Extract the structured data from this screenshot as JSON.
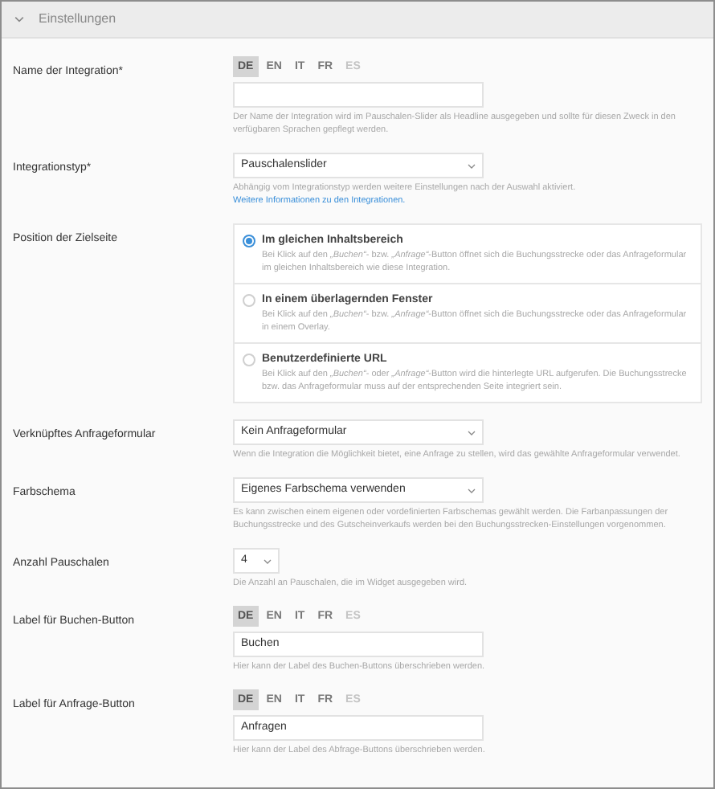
{
  "section": {
    "title": "Einstellungen",
    "expanded": true
  },
  "fields": [
    {
      "kind": "i18n",
      "label": "Name der Integration*",
      "languages": [
        {
          "code": "DE",
          "selected": true,
          "disabled": false
        },
        {
          "code": "EN",
          "selected": false,
          "disabled": false
        },
        {
          "code": "IT",
          "selected": false,
          "disabled": false
        },
        {
          "code": "FR",
          "selected": false,
          "disabled": false
        },
        {
          "code": "ES",
          "selected": false,
          "disabled": true
        }
      ],
      "help": "Der Name der Integration wird im Pauschalen-Slider als Headline ausgegeben und sollte für diesen Zweck in den verfügbaren Sprachen gepflegt werden."
    },
    {
      "kind": "select",
      "label": "Integrationstyp*",
      "value": "Pauschalenslider",
      "help": "Abhängig vom Integrationstyp werden weitere Einstellungen nach der Auswahl aktiviert.",
      "help_link": "Weitere Informationen zu den Integrationen."
    },
    {
      "kind": "radio",
      "label": "Position der Zielseite",
      "options": [
        {
          "title": "Im gleichen Inhaltsbereich",
          "selected": true,
          "description": "Bei Klick auf den *„Buchen“*- bzw. *„Anfrage“*-Button öffnet sich die Buchungsstrecke oder das Anfrageformular im gleichen Inhaltsbereich wie diese Integration."
        },
        {
          "title": "In einem überlagernden Fenster",
          "selected": false,
          "description": "Bei Klick auf den *„Buchen“*- bzw. *„Anfrage“*-Button öffnet sich die Buchungsstrecke oder das Anfrageformular in einem Overlay."
        },
        {
          "title": "Benutzerdefinierte URL",
          "selected": false,
          "description": "Bei Klick auf den *„Buchen“*- oder *„Anfrage“*-Button wird die hinterlegte URL aufgerufen. Die Buchungsstrecke bzw. das Anfrageformular muss auf der entsprechenden Seite integriert sein."
        }
      ]
    },
    {
      "kind": "select",
      "label": "Verknüpftes Anfrageformular",
      "value": "Kein Anfrageformular",
      "help": "Wenn die Integration die Möglichkeit bietet, eine Anfrage zu stellen, wird das gewählte Anfrageformular verwendet."
    },
    {
      "kind": "select",
      "label": "Farbschema",
      "value": "Eigenes Farbschema verwenden",
      "help": "Es kann zwischen einem eigenen oder vordefinierten Farbschemas gewählt werden. Die Farbanpassungen der Buchungsstrecke und des Gutscheinverkaufs werden bei den Buchungsstrecken-Einstellungen vorgenommen."
    },
    {
      "kind": "small_select",
      "label": "Anzahl Pauschalen",
      "value": "4",
      "help": "Die Anzahl an Pauschalen, die im Widget ausgegeben wird."
    },
    {
      "kind": "i18n",
      "label": "Label für Buchen-Button",
      "languages": [
        {
          "code": "DE",
          "selected": true,
          "disabled": false
        },
        {
          "code": "EN",
          "selected": false,
          "disabled": false
        },
        {
          "code": "IT",
          "selected": false,
          "disabled": false
        },
        {
          "code": "FR",
          "selected": false,
          "disabled": false
        },
        {
          "code": "ES",
          "selected": false,
          "disabled": true
        }
      ],
      "value": "Buchen",
      "help": "Hier kann der Label des Buchen-Buttons überschrieben werden."
    },
    {
      "kind": "i18n",
      "label": "Label für Anfrage-Button",
      "languages": [
        {
          "code": "DE",
          "selected": true,
          "disabled": false
        },
        {
          "code": "EN",
          "selected": false,
          "disabled": false
        },
        {
          "code": "IT",
          "selected": false,
          "disabled": false
        },
        {
          "code": "FR",
          "selected": false,
          "disabled": false
        },
        {
          "code": "ES",
          "selected": false,
          "disabled": true
        }
      ],
      "value": "Anfragen",
      "help": "Hier kann der Label des Abfrage-Buttons überschrieben werden."
    }
  ]
}
